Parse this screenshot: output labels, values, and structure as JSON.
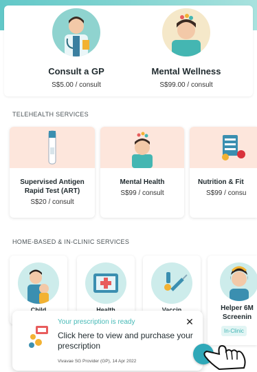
{
  "top_services": [
    {
      "title": "Consult a GP",
      "price": "S$5.00 / consult",
      "icon": "doctor-icon"
    },
    {
      "title": "Mental Wellness",
      "price": "S$99.00 / consult",
      "icon": "mental-wellness-icon"
    }
  ],
  "telehealth": {
    "heading": "TELEHEALTH SERVICES",
    "cards": [
      {
        "title": "Supervised Antigen Rapid Test (ART)",
        "price": "S$20 / consult",
        "icon": "test-tube-icon"
      },
      {
        "title": "Mental Health",
        "price": "S$99 / consult",
        "icon": "mental-health-icon"
      },
      {
        "title": "Nutrition & Fit",
        "price": "S$99 / consu",
        "icon": "nutrition-icon"
      }
    ]
  },
  "home_based": {
    "heading": "HOME-BASED & IN-CLINIC SERVICES",
    "cards": [
      {
        "label": "Child",
        "icon": "child-icon"
      },
      {
        "label": "Health",
        "icon": "health-screening-icon"
      },
      {
        "label": "Vaccin",
        "icon": "vaccine-icon"
      },
      {
        "label": "Helper 6M Screenin",
        "badge": "In-Clinic",
        "icon": "helper-icon"
      }
    ]
  },
  "toast": {
    "heading": "Your prescription is ready",
    "body": "Click here to view and purchase your prescription",
    "footnote": "Vivavae SG Provider (GP), 14 Apr 2022",
    "close": "✕"
  },
  "colors": {
    "accent": "#45b9b6",
    "header": "#7fd3d0",
    "card_thumb": "#fde6dc"
  }
}
